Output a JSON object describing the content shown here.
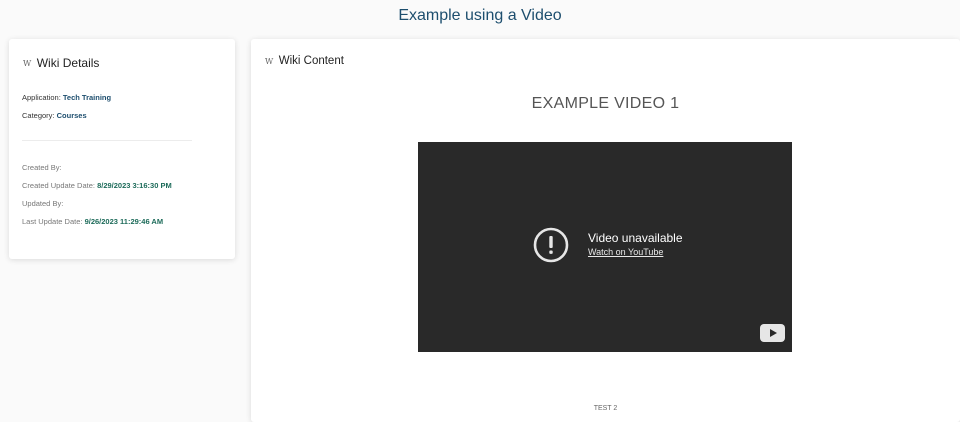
{
  "page": {
    "title": "Example using a Video"
  },
  "details_card": {
    "icon": "wiki-w-icon",
    "icon_glyph": "W",
    "title": "Wiki Details",
    "application_label": "Application:",
    "application_value": "Tech Training",
    "category_label": "Category:",
    "category_value": "Courses",
    "created_by_label": "Created By:",
    "created_update_date_label": "Created Update Date:",
    "created_update_date_value": "8/29/2023 3:16:30 PM",
    "updated_by_label": "Updated By:",
    "last_update_date_label": "Last Update Date:",
    "last_update_date_value": "9/26/2023 11:29:46 AM"
  },
  "content_card": {
    "icon": "wiki-w-icon",
    "icon_glyph": "W",
    "title": "Wiki Content",
    "heading": "EXAMPLE VIDEO 1",
    "video": {
      "status": "Video unavailable",
      "link": "Watch on YouTube",
      "status_icon": "exclamation-circle-icon",
      "logo_icon": "youtube-play-icon"
    },
    "footer_text": "TEST 2"
  },
  "colors": {
    "title": "#1d4e6e",
    "value_link": "#1d4e6e",
    "date_value": "#1d6b5a",
    "video_bg": "#292929"
  }
}
